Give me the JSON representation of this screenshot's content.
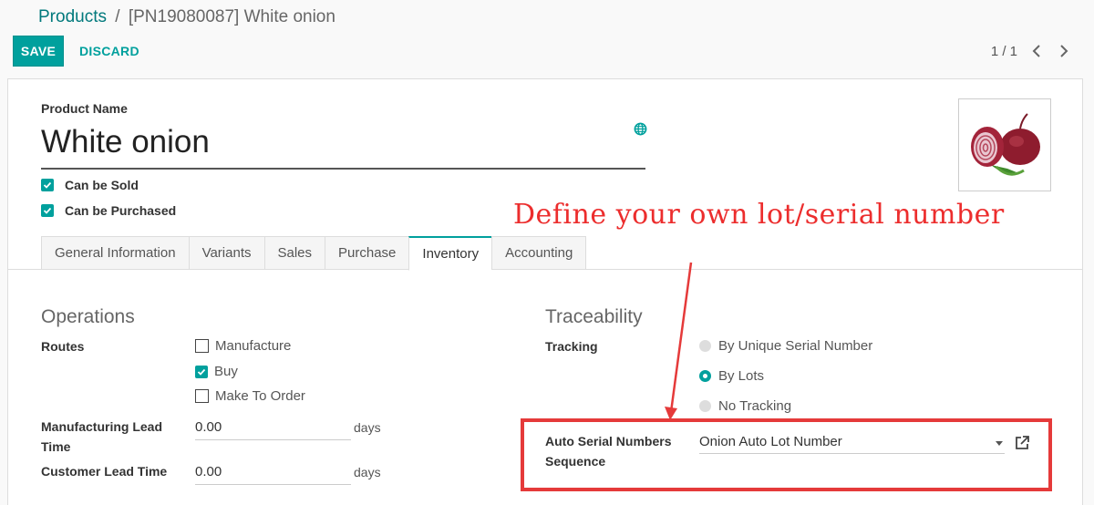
{
  "breadcrumb": {
    "parent": "Products",
    "separator": "/",
    "current": "[PN19080087] White onion"
  },
  "toolbar": {
    "save_label": "SAVE",
    "discard_label": "DISCARD"
  },
  "pager": {
    "value": "1 / 1"
  },
  "product": {
    "name_label": "Product Name",
    "name": "White onion",
    "can_be_sold": "Can be Sold",
    "can_be_purchased": "Can be Purchased"
  },
  "annotation": {
    "text": "Define your own lot/serial number"
  },
  "tabs": [
    {
      "label": "General Information"
    },
    {
      "label": "Variants"
    },
    {
      "label": "Sales"
    },
    {
      "label": "Purchase"
    },
    {
      "label": "Inventory"
    },
    {
      "label": "Accounting"
    }
  ],
  "operations": {
    "title": "Operations",
    "routes_label": "Routes",
    "routes": [
      {
        "label": "Manufacture",
        "checked": false
      },
      {
        "label": "Buy",
        "checked": true
      },
      {
        "label": "Make To Order",
        "checked": false
      }
    ],
    "mfg_lead_label": "Manufacturing Lead Time",
    "mfg_lead_value": "0.00",
    "customer_lead_label": "Customer Lead Time",
    "customer_lead_value": "0.00",
    "unit": "days"
  },
  "traceability": {
    "title": "Traceability",
    "tracking_label": "Tracking",
    "options": [
      {
        "label": "By Unique Serial Number",
        "selected": false
      },
      {
        "label": "By Lots",
        "selected": true
      },
      {
        "label": "No Tracking",
        "selected": false
      }
    ],
    "sequence_label": "Auto Serial Numbers Sequence",
    "sequence_value": "Onion Auto Lot Number"
  },
  "colors": {
    "accent": "#00a09d",
    "link": "#01797c",
    "annotation": "#ec2d2d"
  }
}
